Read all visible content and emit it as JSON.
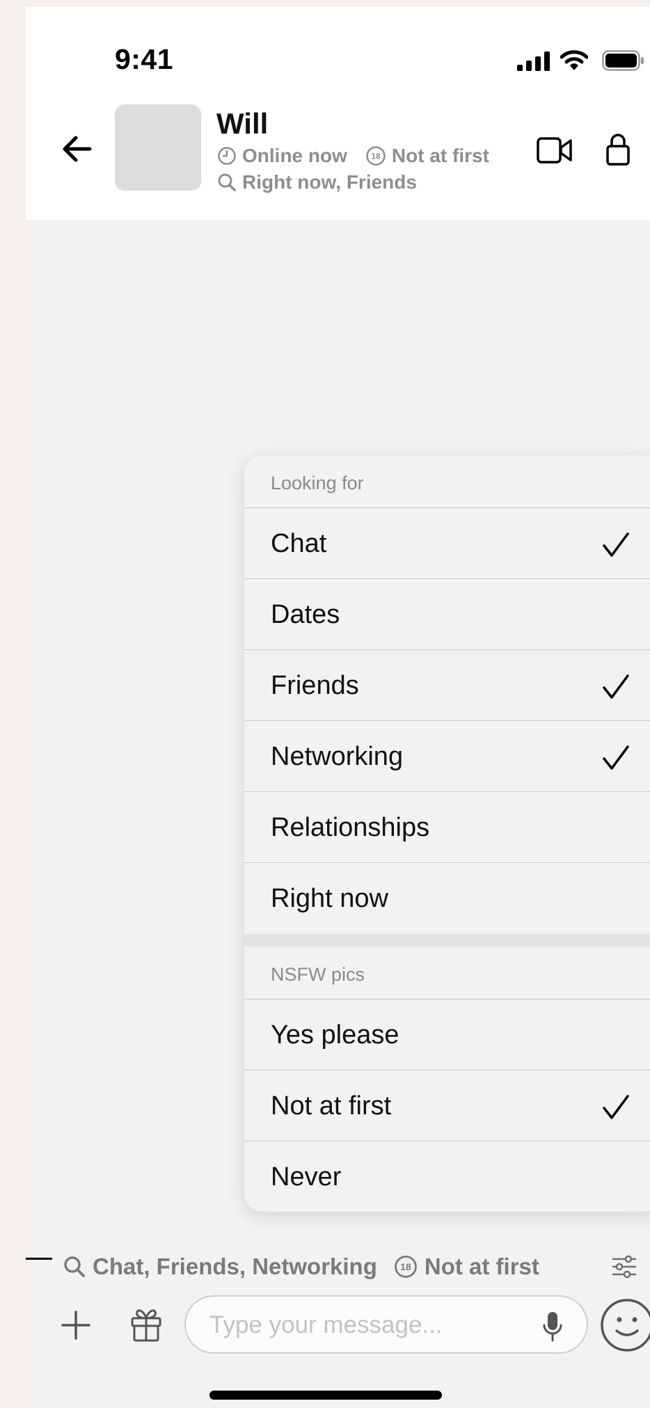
{
  "status_bar": {
    "time": "9:41",
    "icons": [
      "cellular-signal-icon",
      "wifi-icon",
      "battery-icon"
    ]
  },
  "header": {
    "back_icon": "arrow-left-icon",
    "contact_name": "Will",
    "online_status": "Online now",
    "nsfw_status": "Not at first",
    "nsfw_badge": "18",
    "looking_for": "Right now, Friends",
    "actions": [
      "video-call-icon",
      "lock-icon"
    ]
  },
  "menu": {
    "sections": [
      {
        "title": "Looking for",
        "items": [
          {
            "label": "Chat",
            "checked": true
          },
          {
            "label": "Dates",
            "checked": false
          },
          {
            "label": "Friends",
            "checked": true
          },
          {
            "label": "Networking",
            "checked": true
          },
          {
            "label": "Relationships",
            "checked": false
          },
          {
            "label": "Right now",
            "checked": false
          }
        ]
      },
      {
        "title": "NSFW pics",
        "items": [
          {
            "label": "Yes please",
            "checked": false
          },
          {
            "label": "Not at first",
            "checked": true
          },
          {
            "label": "Never",
            "checked": false
          }
        ]
      }
    ]
  },
  "tags_bar": {
    "looking_for": "Chat, Friends, Networking",
    "nsfw_badge": "18",
    "nsfw": "Not at first"
  },
  "compose": {
    "placeholder": "Type your message...",
    "icons": [
      "plus-icon",
      "gift-icon",
      "microphone-icon",
      "emoji-icon"
    ]
  },
  "colors": {
    "screen_background": "#f2f2f2",
    "header_background": "#ffffff",
    "meta_text": "#8e8e8e",
    "placeholder_text": "#c3c3c3"
  }
}
